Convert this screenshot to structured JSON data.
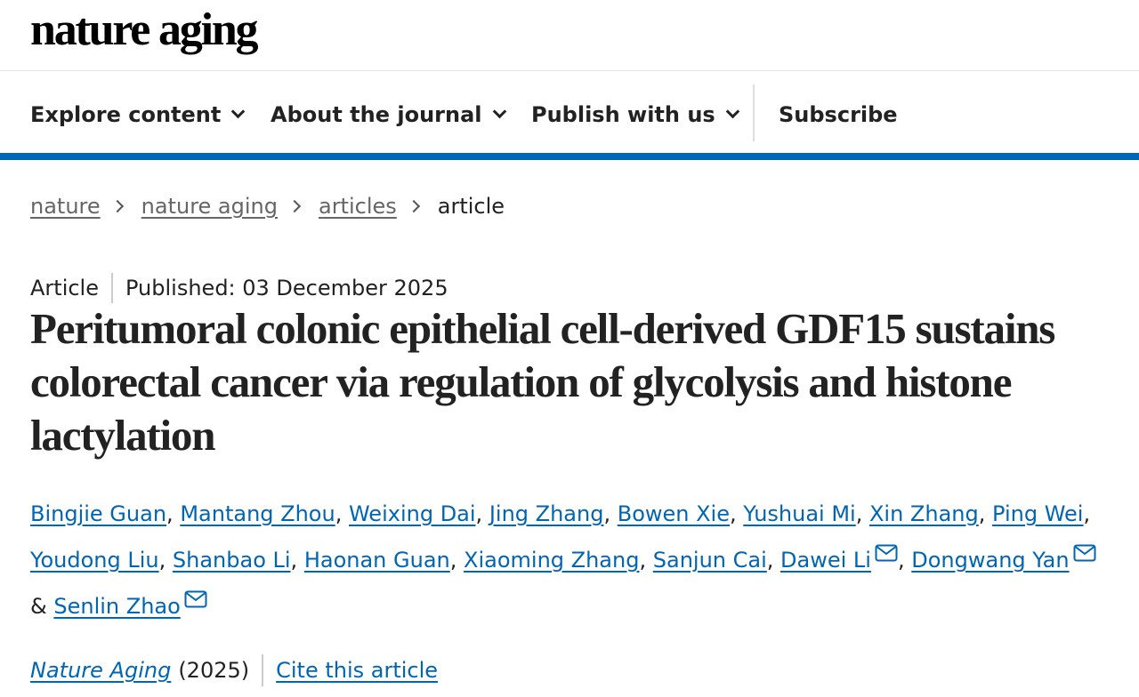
{
  "header": {
    "logo_text": "nature aging"
  },
  "nav": {
    "items": [
      {
        "label": "Explore content",
        "has_dropdown": true
      },
      {
        "label": "About the journal",
        "has_dropdown": true
      },
      {
        "label": "Publish with us",
        "has_dropdown": true
      },
      {
        "label": "Subscribe",
        "has_dropdown": false
      }
    ]
  },
  "breadcrumb": {
    "links": [
      "nature",
      "nature aging",
      "articles"
    ],
    "current": "article"
  },
  "article": {
    "type": "Article",
    "published": "Published: 03 December 2025",
    "title": "Peritumoral colonic epithelial cell-derived GDF15 sustains colorectal cancer via regulation of glycolysis and histone lactylation",
    "authors": [
      "Bingjie Guan",
      "Mantang Zhou",
      "Weixing Dai",
      "Jing Zhang",
      "Bowen Xie",
      "Yushuai Mi",
      "Xin Zhang",
      "Ping Wei",
      "Youdong Liu",
      "Shanbao Li",
      "Haonan Guan",
      "Xiaoming Zhang",
      "Sanjun Cai",
      "Dawei Li",
      "Dongwang Yan",
      "Senlin Zhao"
    ],
    "corresponding_icon": "mail-icon",
    "author_separator": ",",
    "author_conjunction": "&",
    "journal": "Nature Aging",
    "year": "(2025)",
    "cite_label": "Cite this article"
  },
  "colors": {
    "accent": "#0066b3",
    "text": "#222222",
    "muted": "#666666"
  }
}
